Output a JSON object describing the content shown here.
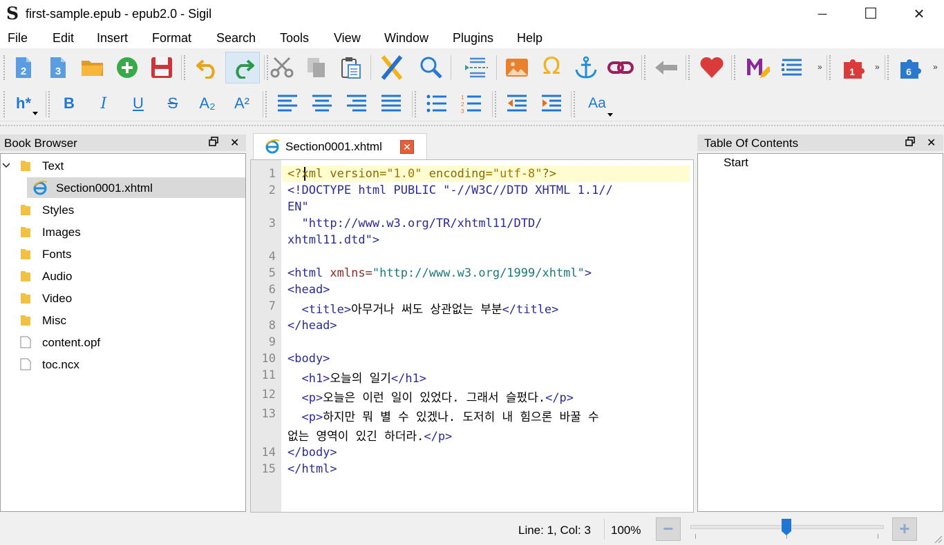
{
  "window": {
    "app_icon": "S",
    "title": "first-sample.epub - epub2.0 - Sigil",
    "minimize": "─",
    "maximize": "☐",
    "close": "✕"
  },
  "menu": [
    "File",
    "Edit",
    "Insert",
    "Format",
    "Search",
    "Tools",
    "View",
    "Window",
    "Plugins",
    "Help"
  ],
  "toolbar": {
    "plugin_badge_1": "1",
    "plugin_badge_6": "6",
    "heading_label": "h*",
    "bold": "B",
    "italic": "I",
    "underline": "U",
    "strike": "S",
    "subscript": "A₂",
    "superscript": "A²",
    "case": "Aa"
  },
  "book_browser": {
    "title": "Book Browser",
    "items": [
      {
        "label": "Text",
        "type": "folder",
        "expanded": true
      },
      {
        "label": "Section0001.xhtml",
        "type": "html",
        "selected": true
      },
      {
        "label": "Styles",
        "type": "folder"
      },
      {
        "label": "Images",
        "type": "folder"
      },
      {
        "label": "Fonts",
        "type": "folder"
      },
      {
        "label": "Audio",
        "type": "folder"
      },
      {
        "label": "Video",
        "type": "folder"
      },
      {
        "label": "Misc",
        "type": "folder"
      },
      {
        "label": "content.opf",
        "type": "file"
      },
      {
        "label": "toc.ncx",
        "type": "file"
      }
    ]
  },
  "editor": {
    "tab_label": "Section0001.xhtml",
    "line_numbers": [
      "1",
      "2",
      "3",
      "4",
      "5",
      "6",
      "7",
      "8",
      "9",
      "10",
      "11",
      "12",
      "13",
      "14",
      "15"
    ]
  },
  "toc": {
    "title": "Table Of Contents",
    "entries": [
      "Start"
    ]
  },
  "status": {
    "position": "Line: 1, Col: 3",
    "zoom": "100%",
    "zoom_out": "−",
    "zoom_in": "+"
  },
  "colors": {
    "accent": "#1e77d3",
    "tag": "#2a2a9a",
    "attribute": "#8a2a2a",
    "value": "#1a7a7a",
    "current_line": "#fdfdd0"
  }
}
